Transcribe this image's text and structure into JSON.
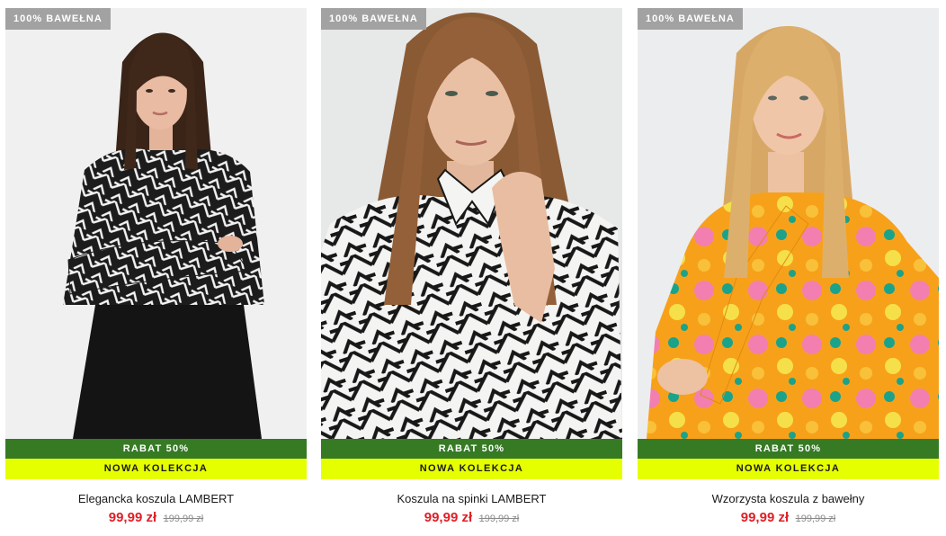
{
  "products": [
    {
      "badge": "100% BAWEŁNA",
      "sale_label": "RABAT 50%",
      "collection_label": "NOWA KOLEKCJA",
      "name": "Elegancka koszula LAMBERT",
      "price": "99,99 zł",
      "old_price": "199,99 zł",
      "image_desc": "woman-black-white-print-shirt-black-skirt"
    },
    {
      "badge": "100% BAWEŁNA",
      "sale_label": "RABAT 50%",
      "collection_label": "NOWA KOLEKCJA",
      "name": "Koszula na spinki LAMBERT",
      "price": "99,99 zł",
      "old_price": "199,99 zł",
      "image_desc": "woman-white-black-geometric-shirt"
    },
    {
      "badge": "100% BAWEŁNA",
      "sale_label": "RABAT 50%",
      "collection_label": "NOWA KOLEKCJA",
      "name": "Wzorzysta koszula z bawełny",
      "price": "99,99 zł",
      "old_price": "199,99 zł",
      "image_desc": "woman-orange-floral-shirt-with-bow"
    }
  ],
  "colors": {
    "sale_strip": "#367a24",
    "new_strip": "#e6ff00",
    "badge_bg": "#a2a2a2",
    "price_current": "#e01f26",
    "price_old": "#8a8a8a"
  }
}
